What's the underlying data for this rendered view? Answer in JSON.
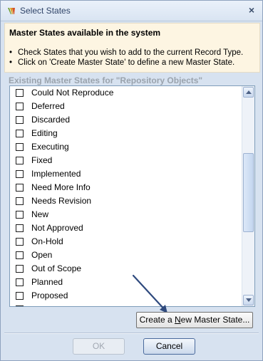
{
  "window": {
    "title": "Select States",
    "close_glyph": "×"
  },
  "info": {
    "heading": "Master States available in the system",
    "bullets": [
      "Check States that you wish to add to the current Record Type.",
      "Click on 'Create Master State' to define a new Master State."
    ]
  },
  "list": {
    "label": "Existing Master States for \"Repository Objects\"",
    "items": [
      {
        "label": "Could Not Reproduce",
        "checked": false
      },
      {
        "label": "Deferred",
        "checked": false
      },
      {
        "label": "Discarded",
        "checked": false
      },
      {
        "label": "Editing",
        "checked": false
      },
      {
        "label": "Executing",
        "checked": false
      },
      {
        "label": "Fixed",
        "checked": false
      },
      {
        "label": "Implemented",
        "checked": false
      },
      {
        "label": "Need More Info",
        "checked": false
      },
      {
        "label": "Needs Revision",
        "checked": false
      },
      {
        "label": "New",
        "checked": false
      },
      {
        "label": "Not Approved",
        "checked": false
      },
      {
        "label": "On-Hold",
        "checked": false
      },
      {
        "label": "Open",
        "checked": false
      },
      {
        "label": "Out of Scope",
        "checked": false
      },
      {
        "label": "Planned",
        "checked": false
      },
      {
        "label": "Proposed",
        "checked": false
      }
    ]
  },
  "buttons": {
    "create_pre": "Create a ",
    "create_underlined": "N",
    "create_post": "ew Master State...",
    "ok": "OK",
    "cancel": "Cancel"
  },
  "colors": {
    "info_background": "#fdf5e2",
    "dialog_background": "#d7e2f0",
    "pointer_arrow": "#2f4a7e",
    "section_label": "#9aa3ad"
  },
  "icons": {
    "app": "app-logo-icon",
    "close": "close-icon",
    "scroll_up": "chevron-up-icon",
    "scroll_down": "chevron-down-icon",
    "pointer": "pointer-arrow-icon"
  }
}
